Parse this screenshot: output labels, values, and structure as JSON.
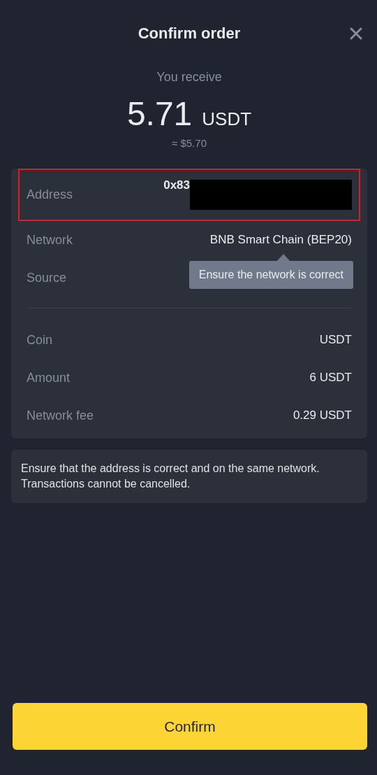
{
  "header": {
    "title": "Confirm order"
  },
  "summary": {
    "label": "You receive",
    "amount": "5.71",
    "unit": "USDT",
    "approx": "≈ $5.70"
  },
  "details": [
    {
      "label": "Address",
      "value": "0x83",
      "highlighted": true,
      "redacted": true
    },
    {
      "label": "Network",
      "value": "BNB Smart Chain (BEP20)"
    },
    {
      "label": "Source"
    }
  ],
  "tooltip": "Ensure the network is correct",
  "amounts": [
    {
      "label": "Coin",
      "value": "USDT"
    },
    {
      "label": "Amount",
      "value": "6 USDT"
    },
    {
      "label": "Network fee",
      "value": "0.29 USDT"
    }
  ],
  "notice": "Ensure that the address is correct and on the same network. Transactions cannot be cancelled.",
  "confirm_button": "Confirm"
}
